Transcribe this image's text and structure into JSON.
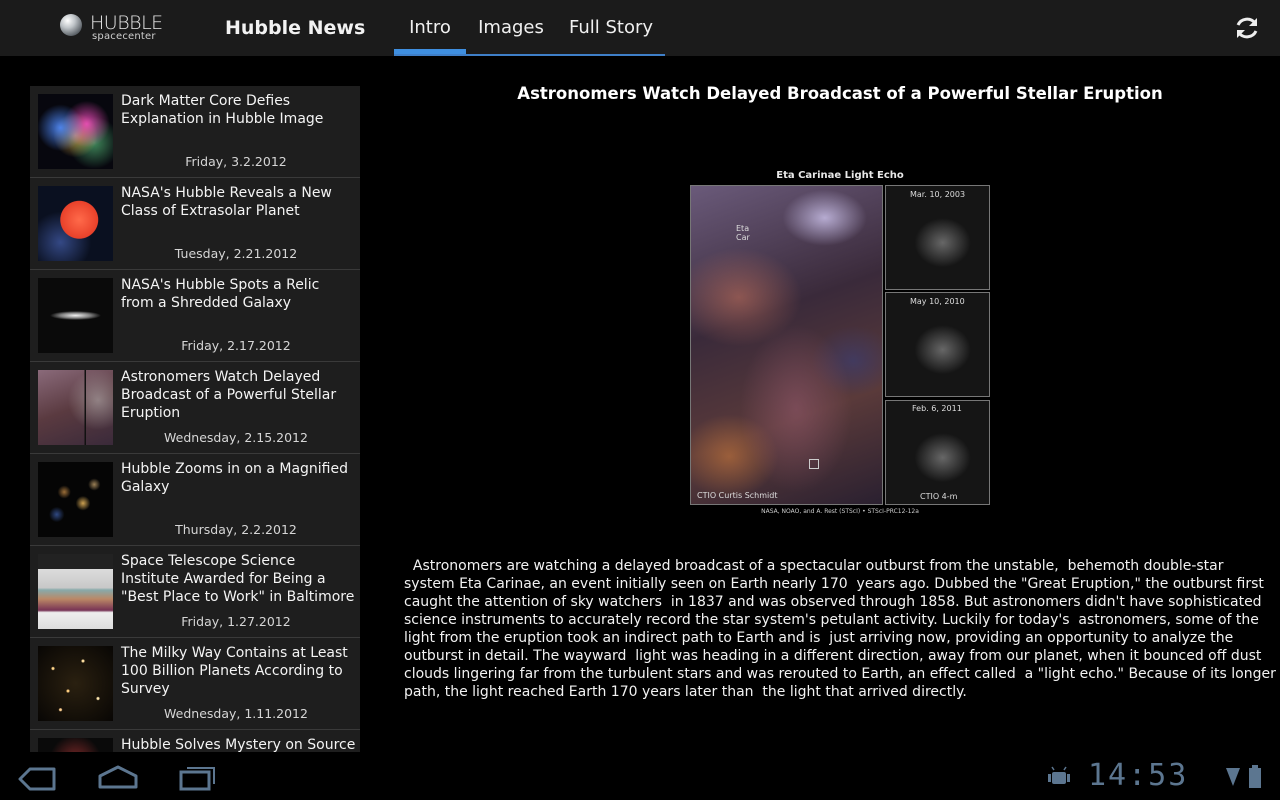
{
  "app": {
    "logo_word": "HUBBLE",
    "logo_sub": "spacecenter",
    "title": "Hubble News"
  },
  "tabs": [
    {
      "label": "Intro",
      "active": true
    },
    {
      "label": "Images",
      "active": false
    },
    {
      "label": "Full Story",
      "active": false
    }
  ],
  "icons": {
    "refresh": "refresh-icon",
    "back": "back-icon",
    "home": "home-icon",
    "recent": "recent-apps-icon",
    "notification": "android-notification-icon",
    "signal": "signal-icon",
    "battery": "battery-icon"
  },
  "colors": {
    "accent": "#3f8fe0",
    "actionbar": "#1b1b1b",
    "list_bg": "#1e1e1e",
    "clock": "#5c7690"
  },
  "news": [
    {
      "title": "Dark Matter Core Defies Explanation in Hubble Image",
      "date": "Friday, 3.2.2012",
      "thumb": "dark-matter"
    },
    {
      "title": "NASA's Hubble Reveals a New Class of Extrasolar Planet",
      "date": "Tuesday, 2.21.2012",
      "thumb": "red-planet"
    },
    {
      "title": "NASA's Hubble Spots a Relic from a Shredded Galaxy",
      "date": "Friday, 2.17.2012",
      "thumb": "edge-galaxy"
    },
    {
      "title": "Astronomers Watch Delayed Broadcast of a Powerful Stellar Eruption",
      "date": "Wednesday, 2.15.2012",
      "thumb": "eta-carinae"
    },
    {
      "title": "Hubble Zooms in on a Magnified Galaxy",
      "date": "Thursday, 2.2.2012",
      "thumb": "magnified"
    },
    {
      "title": "Space Telescope Science Institute Awarded for Being a \"Best Place to Work\" in  Baltimore",
      "date": "Friday, 1.27.2012",
      "thumb": "crowd"
    },
    {
      "title": "The Milky Way Contains at Least 100 Billion Planets According to Survey",
      "date": "Wednesday, 1.11.2012",
      "thumb": "starfield"
    },
    {
      "title": "Hubble Solves Mystery on Source",
      "date": "",
      "thumb": "partial"
    }
  ],
  "article": {
    "headline": "Astronomers Watch Delayed Broadcast of a Powerful Stellar Eruption",
    "figure": {
      "title": "Eta Carinae Light Echo",
      "star_label": "Eta\nCar",
      "panel_dates": [
        "Mar. 10, 2003",
        "May 10, 2010",
        "Feb. 6, 2011"
      ],
      "credit_left": "CTIO Curtis Schmidt",
      "credit_right": "CTIO 4-m",
      "credit_bottom": "NASA, NOAO, and A. Rest (STScI) • STScI-PRC12-12a"
    },
    "body": "  Astronomers are watching a delayed broadcast of a spectacular outburst from the unstable,  behemoth double-star system Eta Carinae, an event initially seen on Earth nearly 170  years ago. Dubbed the \"Great Eruption,\" the outburst first caught the attention of sky watchers  in 1837 and was observed through 1858. But astronomers didn't have sophisticated science instruments to accurately record the star system's petulant activity. Luckily for today's  astronomers, some of the light from the eruption took an indirect path to Earth and is  just arriving now, providing an opportunity to analyze the outburst in detail. The wayward  light was heading in a different direction, away from our planet, when it bounced off dust  clouds lingering far from the turbulent stars and was rerouted to Earth, an effect called  a \"light echo.\" Because of its longer path, the light reached Earth 170 years later than  the light that arrived directly."
  },
  "status": {
    "clock": "14:53"
  }
}
